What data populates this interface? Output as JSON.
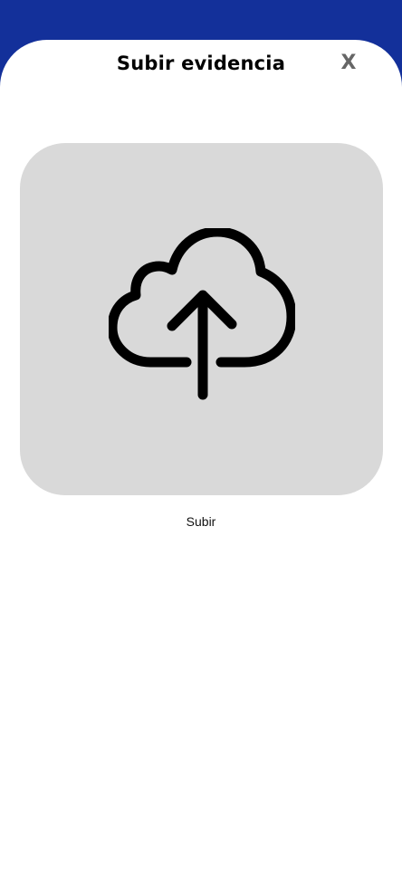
{
  "modal": {
    "title": "Subir evidencia",
    "close_label": "X"
  },
  "upload": {
    "icon": "cloud-upload-icon",
    "label": "Subir"
  },
  "colors": {
    "header_background": "#13309a",
    "upload_box_background": "#d9d9d9",
    "close_color": "#666666"
  }
}
